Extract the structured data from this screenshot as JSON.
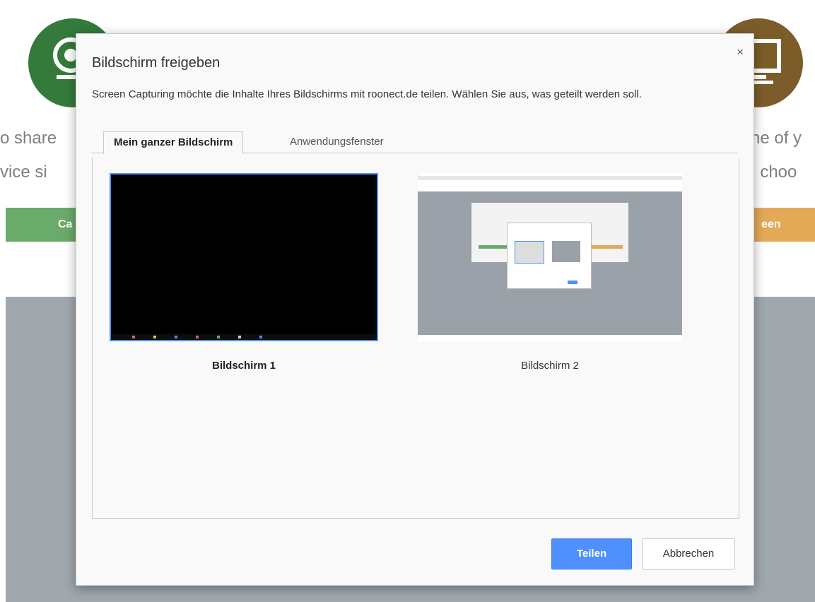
{
  "background": {
    "left_text_line1": "o share",
    "left_text_line2": "vice si",
    "right_text_line1": "ne of y",
    "right_text_line2": ", choo",
    "left_button_label": "Ca",
    "right_button_label": "een",
    "left_circle_icon": "webcam-icon",
    "right_circle_icon": "monitor-icon",
    "colors": {
      "green": "#347a3a",
      "brown": "#7c5d2a",
      "gray": "#a0a7ad"
    }
  },
  "dialog": {
    "title": "Bildschirm freigeben",
    "close_symbol": "×",
    "description": "Screen Capturing möchte die Inhalte Ihres Bildschirms mit roonect.de teilen. Wählen Sie aus, was geteilt werden soll.",
    "tabs": [
      {
        "label": "Mein ganzer Bildschirm",
        "active": true
      },
      {
        "label": "Anwendungsfenster",
        "active": false
      }
    ],
    "sources": [
      {
        "label": "Bildschirm 1",
        "selected": true
      },
      {
        "label": "Bildschirm 2",
        "selected": false
      }
    ],
    "buttons": {
      "share": "Teilen",
      "cancel": "Abbrechen"
    },
    "accent_color": "#4d90fe"
  }
}
